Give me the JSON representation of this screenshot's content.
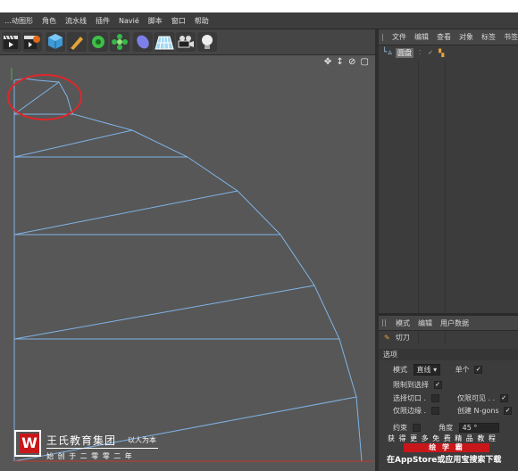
{
  "menubar": {
    "items": [
      "…动图形",
      "角色",
      "流水线",
      "插件",
      "Navié",
      "脚本",
      "窗口",
      "帮助"
    ]
  },
  "toolbar": {
    "icons": [
      "clapper-icon",
      "clapper-settings-icon",
      "cube-icon",
      "pen-icon",
      "gear-shape-icon",
      "flower-shape-icon",
      "capsule-icon",
      "floor-grid-icon",
      "camera-icon",
      "light-bulb-icon"
    ]
  },
  "viewport": {
    "nav_glyphs": "✥ ↕ ⊘ ▢"
  },
  "objects": {
    "tabs": [
      "文件",
      "编辑",
      "查看",
      "对象",
      "标签",
      "书签"
    ],
    "item": "圆盘"
  },
  "attributes": {
    "tabs": [
      "模式",
      "编辑",
      "用户数据"
    ],
    "tool": "切刀",
    "section": "选项",
    "mode_label": "模式",
    "mode_value": "直线",
    "single_label": "单个",
    "restrict_label": "限制到选择",
    "select_cut_label": "选择切口 .",
    "visible_only_label": "仅限可见 . .",
    "edges_only_label": "仅限边缘 .",
    "create_ngons_label": "创建 N-gons",
    "constrain_label": "约束",
    "angle_label": "角度",
    "angle_value": "45 °"
  },
  "watermark": {
    "logo_char": "W",
    "company": "王氏教育集团",
    "slogan": "以人为本",
    "founded": "始 创 于 二 零 零 二 年",
    "promo_line1": "获 得 更 多 免 费 精 品 教 程",
    "promo_badge": "绘 学 霸",
    "promo_line2": "在AppStore或应用宝搜索下载"
  }
}
